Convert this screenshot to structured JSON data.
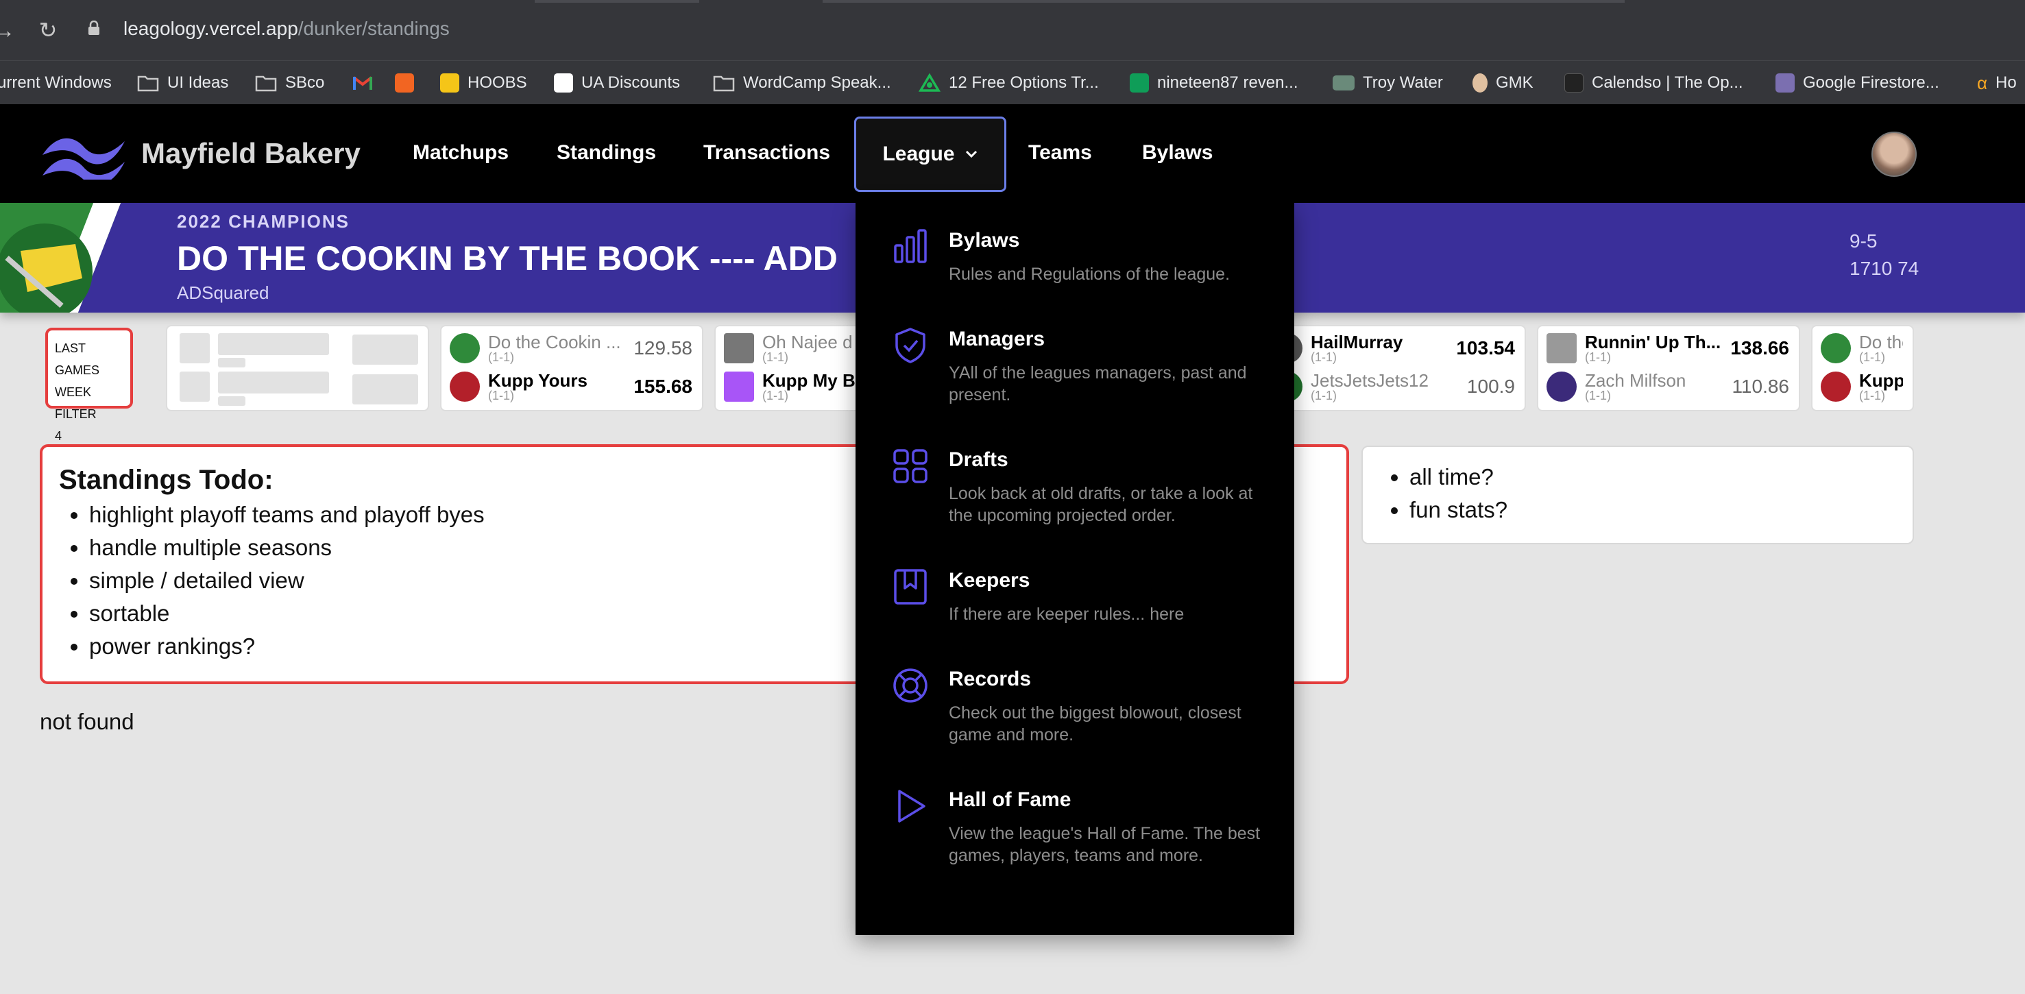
{
  "browser": {
    "back_glyph": "→",
    "reload_glyph": "↻",
    "url_host": "leagology.vercel.app",
    "url_path": "/dunker/standings"
  },
  "bookmarks": [
    {
      "label": "urrent Windows",
      "icon": "folder-icon",
      "color": "#35363a"
    },
    {
      "label": "UI Ideas",
      "icon": "folder-icon",
      "color": "#35363a"
    },
    {
      "label": "SBco",
      "icon": "folder-icon",
      "color": "#35363a"
    },
    {
      "label": "",
      "icon": "gmail-icon",
      "color": "#ea4335"
    },
    {
      "label": "",
      "icon": "hubspot-icon",
      "color": "#f26522"
    },
    {
      "label": "HOOBS",
      "icon": "hoobs-icon",
      "color": "#f5c518"
    },
    {
      "label": "UA Discounts",
      "icon": "underarmour-icon",
      "color": "#ffffff"
    },
    {
      "label": "WordCamp Speak...",
      "icon": "folder-icon",
      "color": "#35363a"
    },
    {
      "label": "12 Free Options Tr...",
      "icon": "options-icon",
      "color": "#1db954"
    },
    {
      "label": "nineteen87 reven...",
      "icon": "sheets-icon",
      "color": "#0f9d58"
    },
    {
      "label": "Troy Water",
      "icon": "troy-water-icon",
      "color": "#6a8a7a"
    },
    {
      "label": "GMK",
      "icon": "gmk-icon",
      "color": "#e0c0a0"
    },
    {
      "label": "Calendso | The Op...",
      "icon": "calendso-icon",
      "color": "#222222"
    },
    {
      "label": "Google Firestore...",
      "icon": "firestore-icon",
      "color": "#7b6fb0"
    },
    {
      "label": "Ho",
      "icon": "alpha-icon",
      "color": "#f5a623"
    }
  ],
  "header": {
    "brand": "Mayfield Bakery",
    "nav": {
      "matchups": "Matchups",
      "standings": "Standings",
      "transactions": "Transactions",
      "league": "League",
      "teams": "Teams",
      "bylaws": "Bylaws"
    }
  },
  "banner": {
    "kicker": "2022 CHAMPIONS",
    "title": "DO THE COOKIN BY THE BOOK ---- ADD",
    "owner": "ADSquared",
    "record": "9-5",
    "points": "1710 74"
  },
  "scores": {
    "filter": {
      "line1": "LAST GAMES",
      "line2": "WEEK FILTER",
      "line3": "4"
    },
    "games": [
      {
        "home": {
          "name": "Do the Cookin ...",
          "record": "(1-1)",
          "score": "129.58",
          "winner": false
        },
        "away": {
          "name": "Kupp Yours",
          "record": "(1-1)",
          "score": "155.68",
          "winner": true
        }
      },
      {
        "home": {
          "name": "Oh Najee d",
          "record": "(1-1)",
          "score": "",
          "winner": false
        },
        "away": {
          "name": "Kupp My Bo",
          "record": "(1-1)",
          "score": "",
          "winner": true
        }
      },
      {
        "home": {
          "name": "HailMurray",
          "record": "(1-1)",
          "score": "103.54",
          "winner": true
        },
        "away": {
          "name": "JetsJetsJets12",
          "record": "(1-1)",
          "score": "100.9",
          "winner": false
        }
      },
      {
        "home": {
          "name": "Runnin' Up Th...",
          "record": "(1-1)",
          "score": "138.66",
          "winner": true
        },
        "away": {
          "name": "Zach Milfson",
          "record": "(1-1)",
          "score": "110.86",
          "winner": false
        }
      },
      {
        "home": {
          "name": "Do the",
          "record": "(1-1)",
          "score": "",
          "winner": false
        },
        "away": {
          "name": "Kupp Y",
          "record": "(1-1)",
          "score": "",
          "winner": true
        }
      }
    ]
  },
  "todo": {
    "title": "Standings Todo:",
    "items": [
      "highlight playoff teams and playoff byes",
      "handle multiple seasons",
      "simple / detailed view",
      "sortable",
      "power rankings?"
    ]
  },
  "notes": {
    "items": [
      "all time?",
      "fun stats?"
    ]
  },
  "status": {
    "not_found": "not found"
  },
  "dropdown": {
    "accent": "#5b4ee8",
    "items": [
      {
        "title": "Bylaws",
        "desc": "Rules and Regulations of the league.",
        "icon": "bar-chart-icon"
      },
      {
        "title": "Managers",
        "desc": "YAll of the leagues managers, past and present.",
        "icon": "shield-check-icon"
      },
      {
        "title": "Drafts",
        "desc": "Look back at old drafts, or take a look at the upcoming projected order.",
        "icon": "grid-icon"
      },
      {
        "title": "Keepers",
        "desc": "If there are keeper rules... here",
        "icon": "bookmark-icon"
      },
      {
        "title": "Records",
        "desc": "Check out the biggest blowout, closest game and more.",
        "icon": "lifebuoy-icon"
      },
      {
        "title": "Hall of Fame",
        "desc": "View the league's Hall of Fame. The best games, players, teams and more.",
        "icon": "play-icon"
      }
    ]
  }
}
